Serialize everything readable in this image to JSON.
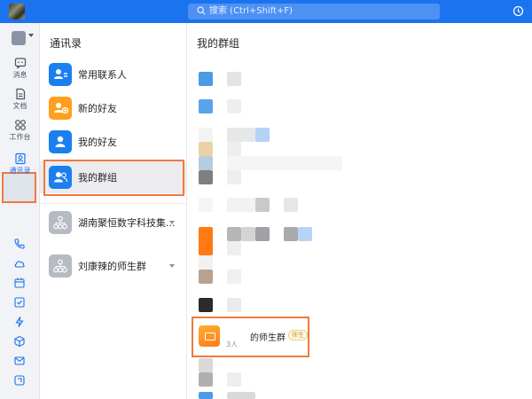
{
  "topbar": {
    "search_placeholder": "搜索 (Ctrl+Shift+F)"
  },
  "rail": {
    "items": [
      {
        "label": "消息",
        "icon": "chat-icon"
      },
      {
        "label": "文档",
        "icon": "document-icon"
      },
      {
        "label": "工作台",
        "icon": "workbench-icon"
      },
      {
        "label": "通讯录",
        "icon": "contacts-icon",
        "active": true
      }
    ],
    "bottom_icons": [
      "phone-icon",
      "cloud-icon",
      "calendar-icon",
      "task-icon",
      "lightning-icon",
      "box-icon",
      "mail-icon",
      "more-icon"
    ]
  },
  "contacts": {
    "title": "通讯录",
    "items": [
      {
        "label": "常用联系人",
        "color": "#1b7ff0"
      },
      {
        "label": "新的好友",
        "color": "#ff9f1c"
      },
      {
        "label": "我的好友",
        "color": "#1b7ff0"
      },
      {
        "label": "我的群组",
        "color": "#1b7ff0",
        "selected": true
      }
    ],
    "orgs": [
      {
        "label": "湖南聚恒数字科技集..."
      },
      {
        "label": "刘康辣的师生群"
      }
    ]
  },
  "main": {
    "title": "我的群组",
    "highlighted_group": {
      "name": "的师生群",
      "tag": "师生",
      "count": "3人"
    }
  },
  "colors": {
    "brand": "#1b73f0",
    "highlight": "#f0793f"
  }
}
